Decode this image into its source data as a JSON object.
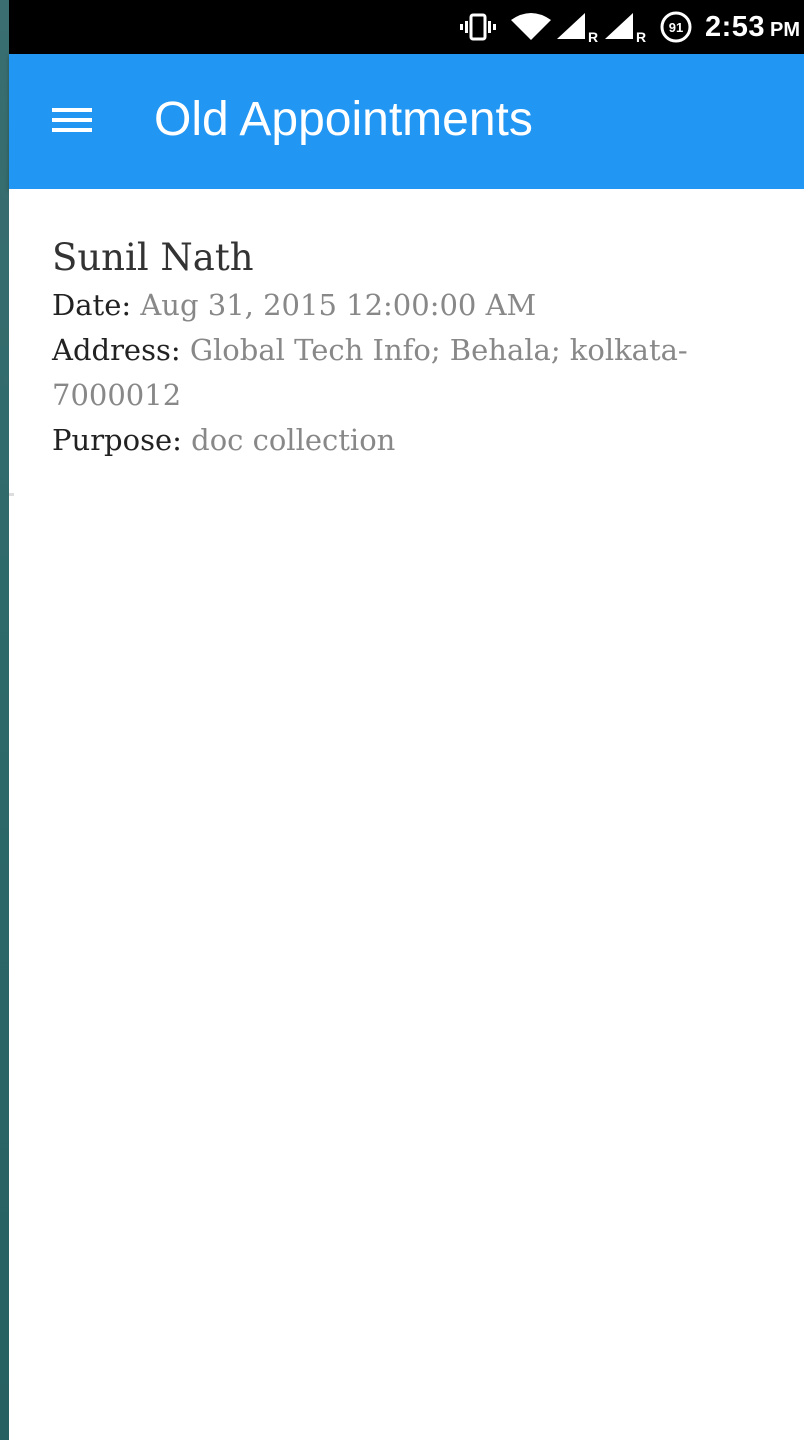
{
  "status_bar": {
    "time": "2:53",
    "ampm": "PM",
    "battery_level": "91",
    "icons": [
      "vibrate-icon",
      "wifi-icon",
      "signal-roaming-icon",
      "signal-roaming-icon",
      "battery-icon"
    ]
  },
  "app_bar": {
    "title": "Old Appointments",
    "color": "#2196f3",
    "menu_icon": "hamburger-menu-icon"
  },
  "appointments": [
    {
      "name": "Sunil Nath",
      "date_label": "Date:",
      "date": "Aug 31, 2015 12:00:00 AM",
      "address_label": "Address:",
      "address": "Global Tech Info; Behala; kolkata-7000012",
      "purpose_label": "Purpose:",
      "purpose": "doc collection"
    }
  ]
}
